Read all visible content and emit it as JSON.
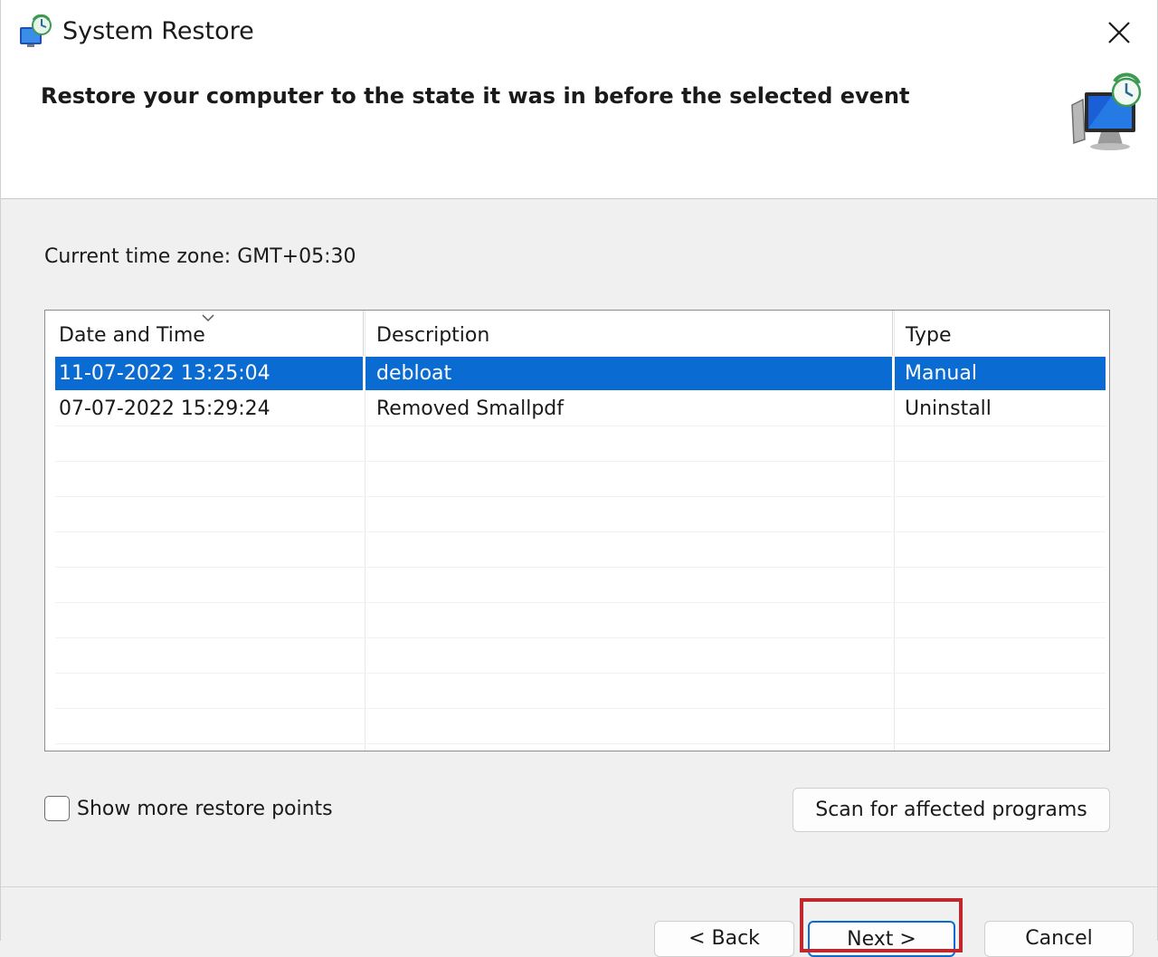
{
  "window": {
    "title": "System Restore",
    "heading": "Restore your computer to the state it was in before the selected event"
  },
  "timezone": "Current time zone: GMT+05:30",
  "table": {
    "columns": [
      "Date and Time",
      "Description",
      "Type"
    ],
    "rows": [
      {
        "date": "11-07-2022 13:25:04",
        "description": "debloat",
        "type": "Manual",
        "selected": true
      },
      {
        "date": "07-07-2022 15:29:24",
        "description": "Removed Smallpdf",
        "type": "Uninstall",
        "selected": false
      }
    ]
  },
  "show_more": {
    "label": "Show more restore points",
    "checked": false
  },
  "scan_button": "Scan for affected programs",
  "footer": {
    "back_label": "< Back",
    "next_label": "Next >",
    "cancel_label": "Cancel"
  },
  "colors": {
    "selection": "#0a6cd2",
    "highlight_box": "#c0282d"
  }
}
